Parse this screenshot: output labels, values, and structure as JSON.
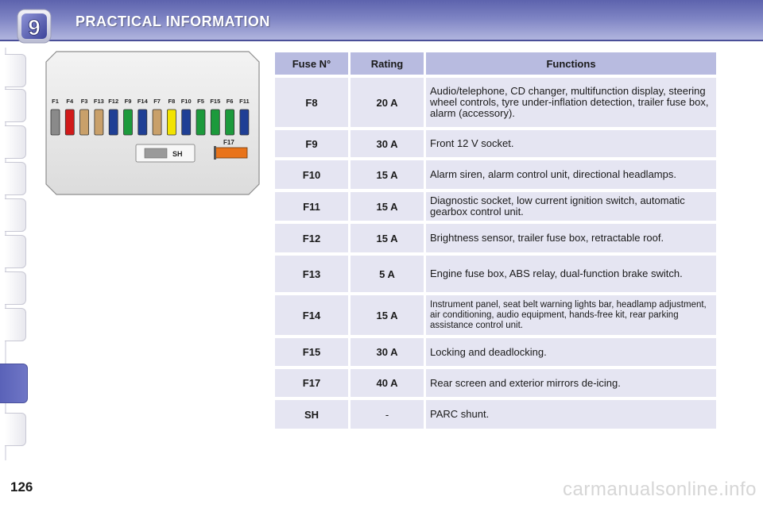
{
  "header": {
    "chapter_number": "9",
    "title": "PRACTICAL INFORMATION",
    "color_dark": "#5d63ad",
    "color_light": "#b5b9e0"
  },
  "fusebox": {
    "fuse_labels": [
      "F1",
      "F4",
      "F3",
      "F13",
      "F12",
      "F9",
      "F14",
      "F7",
      "F8",
      "F10",
      "F5",
      "F15",
      "F6",
      "F11"
    ],
    "fuse_colors": [
      "#8a8a8a",
      "#d11a1a",
      "#c9a06a",
      "#c9a06a",
      "#1f3f95",
      "#1c9a3c",
      "#1f3f95",
      "#c9a06a",
      "#f2e300",
      "#1f3f95",
      "#1c9a3c",
      "#1c9a3c",
      "#1c9a3c",
      "#1f3f95"
    ],
    "shunt_label": "SH",
    "f17_label": "F17",
    "f17_color": "#e8731a"
  },
  "table": {
    "headers": [
      "Fuse N°",
      "Rating",
      "Functions"
    ],
    "rows": [
      {
        "fuse": "F8",
        "rating": "20 A",
        "functions": "Audio/telephone, CD changer, multifunction display, steering wheel controls, tyre under-inflation detection, trailer fuse box, alarm (accessory)."
      },
      {
        "fuse": "F9",
        "rating": "30 A",
        "functions": "Front 12 V socket."
      },
      {
        "fuse": "F10",
        "rating": "15 A",
        "functions": "Alarm siren, alarm control unit, directional headlamps."
      },
      {
        "fuse": "F11",
        "rating": "15 A",
        "functions": "Diagnostic socket, low current ignition switch, automatic gearbox control unit."
      },
      {
        "fuse": "F12",
        "rating": "15 A",
        "functions": "Brightness sensor, trailer fuse box, retractable roof."
      },
      {
        "fuse": "F13",
        "rating": "5 A",
        "functions": "Engine fuse box, ABS relay, dual-function brake switch."
      },
      {
        "fuse": "F14",
        "rating": "15 A",
        "functions": "Instrument panel, seat belt warning lights bar, headlamp adjustment, air conditioning, audio equipment, hands-free kit, rear parking assistance control unit."
      },
      {
        "fuse": "F15",
        "rating": "30 A",
        "functions": "Locking and deadlocking."
      },
      {
        "fuse": "F17",
        "rating": "40 A",
        "functions": "Rear screen and exterior mirrors de-icing."
      },
      {
        "fuse": "SH",
        "rating": "-",
        "functions": "PARC shunt."
      }
    ],
    "header_color": "#b8bbe0",
    "cell_color": "#e5e5f2"
  },
  "footer": {
    "page_number": "126",
    "watermark": "carmanualsonline.info"
  }
}
